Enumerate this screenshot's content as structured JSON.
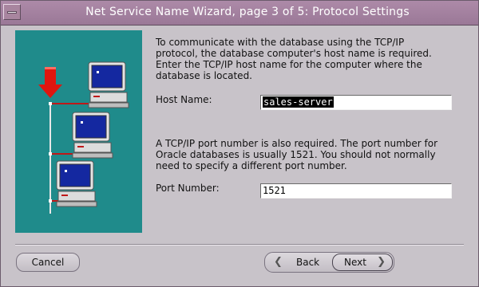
{
  "window": {
    "title": "Net Service Name Wizard, page 3 of 5: Protocol Settings"
  },
  "instructions": {
    "host_lines": [
      "To communicate with the database using the TCP/IP",
      "protocol, the database computer's host name is required.",
      "Enter the TCP/IP host name for the computer where the",
      "database is located."
    ],
    "port_lines": [
      "A TCP/IP port number is also required.  The port number for",
      "Oracle databases is usually 1521.  You should not normally",
      "need to specify a different port number."
    ]
  },
  "form": {
    "host_label": "Host Name:",
    "host_value": "sales-server",
    "port_label": "Port Number:",
    "port_value": "1521"
  },
  "buttons": {
    "cancel": "Cancel",
    "back": "Back",
    "next": "Next"
  },
  "colors": {
    "title_bar": "#9a7897",
    "illustration_bg": "#1f8b8b",
    "arrow": "#e0160f",
    "screen": "#1428a0"
  }
}
